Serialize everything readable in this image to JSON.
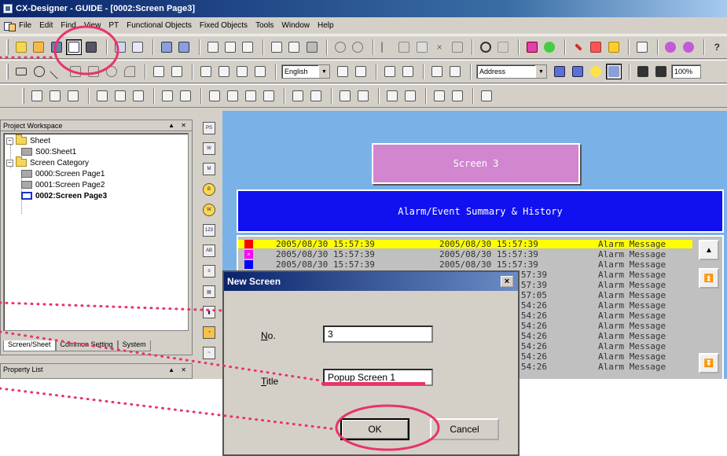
{
  "window": {
    "title": "CX-Designer - GUIDE - [0002:Screen Page3]"
  },
  "menubar": {
    "items": [
      "File",
      "Edit",
      "Find",
      "View",
      "PT",
      "Functional Objects",
      "Fixed Objects",
      "Tools",
      "Window",
      "Help"
    ]
  },
  "toolbar": {
    "language_combo": "English",
    "address_combo": "Address",
    "zoom_combo": "100%"
  },
  "workspace": {
    "title": "Project Workspace",
    "tree": {
      "sheet_folder": "Sheet",
      "sheet_item": "S00:Sheet1",
      "category_folder": "Screen Category",
      "pages": [
        "0000:Screen Page1",
        "0001:Screen Page2",
        "0002:Screen Page3"
      ]
    },
    "tabs": [
      "Screen/Sheet",
      "Common Setting",
      "System"
    ]
  },
  "property_list": {
    "title": "Property List"
  },
  "canvas": {
    "screen_button": "Screen 3",
    "alarm_banner": "Alarm/Event Summary & History",
    "alarm_rows": [
      {
        "date1": "2005/08/30  15:57:39",
        "date2": "2005/08/30  15:57:39",
        "msg": "Alarm Message"
      },
      {
        "date1": "2005/08/30  15:57:39",
        "date2": "2005/08/30  15:57:39",
        "msg": "Alarm Message"
      },
      {
        "date1": "2005/08/30  15:57:39",
        "date2": "2005/08/30  15:57:39",
        "msg": "Alarm Message"
      },
      {
        "date1": "",
        "date2": "15:57:39",
        "msg": "Alarm Message"
      },
      {
        "date1": "",
        "date2": "15:57:39",
        "msg": "Alarm Message"
      },
      {
        "date1": "",
        "date2": "15:57:05",
        "msg": "Alarm Message"
      },
      {
        "date1": "",
        "date2": "15:54:26",
        "msg": "Alarm Message"
      },
      {
        "date1": "",
        "date2": "15:54:26",
        "msg": "Alarm Message"
      },
      {
        "date1": "",
        "date2": "15:54:26",
        "msg": "Alarm Message"
      },
      {
        "date1": "",
        "date2": "15:54:26",
        "msg": "Alarm Message"
      },
      {
        "date1": "",
        "date2": "15:54:26",
        "msg": "Alarm Message"
      },
      {
        "date1": "",
        "date2": "15:54:26",
        "msg": "Alarm Message"
      },
      {
        "date1": "",
        "date2": "15:54:26",
        "msg": "Alarm Message"
      }
    ]
  },
  "dialog": {
    "title": "New Screen",
    "no_label": "No.",
    "no_value": "3",
    "title_label": "Title",
    "title_value": "Popup Screen 1",
    "ok_label": "OK",
    "cancel_label": "Cancel",
    "close_glyph": "×"
  },
  "colors": {
    "annotation": "#e8336a",
    "canvas": "#7ab2e8",
    "screen_button": "#d186cf",
    "alarm_banner": "#1010f0"
  }
}
